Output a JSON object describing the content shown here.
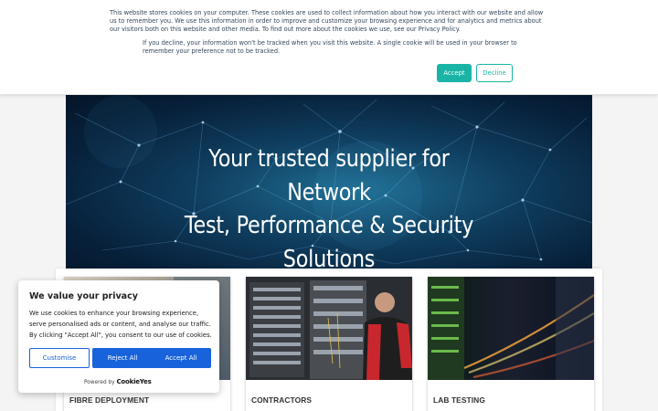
{
  "top_banner": {
    "paragraph1": "This website stores cookies on your computer. These cookies are used to collect information about how you interact with our website and allow us to remember you. We use this information in order to improve and customize your browsing experience and for analytics and metrics about our visitors both on this website and other media. To find out more about the cookies we use, see our Privacy Policy.",
    "paragraph2": "If you decline, your information won't be tracked when you visit this website. A single cookie will be used in your browser to remember your preference not to be tracked.",
    "accept_label": "Accept",
    "decline_label": "Decline",
    "accent_color": "#19b4a6"
  },
  "hero": {
    "line1": "Your trusted supplier for Network",
    "line2": "Test, Performance & Security",
    "line3": "Solutions"
  },
  "cards": [
    {
      "label": "FIBRE DEPLOYMENT"
    },
    {
      "label": "CONTRACTORS"
    },
    {
      "label": "LAB TESTING"
    }
  ],
  "cookie_consent": {
    "title": "We value your privacy",
    "body": "We use cookies to enhance your browsing experience, serve personalised ads or content, and analyse our traffic. By clicking \"Accept All\", you consent to our use of cookies.",
    "customise_label": "Customise",
    "reject_label": "Reject All",
    "accept_label": "Accept All",
    "powered_by": "Powered by",
    "brand": "CookieYes",
    "accent_color": "#1863dc"
  }
}
